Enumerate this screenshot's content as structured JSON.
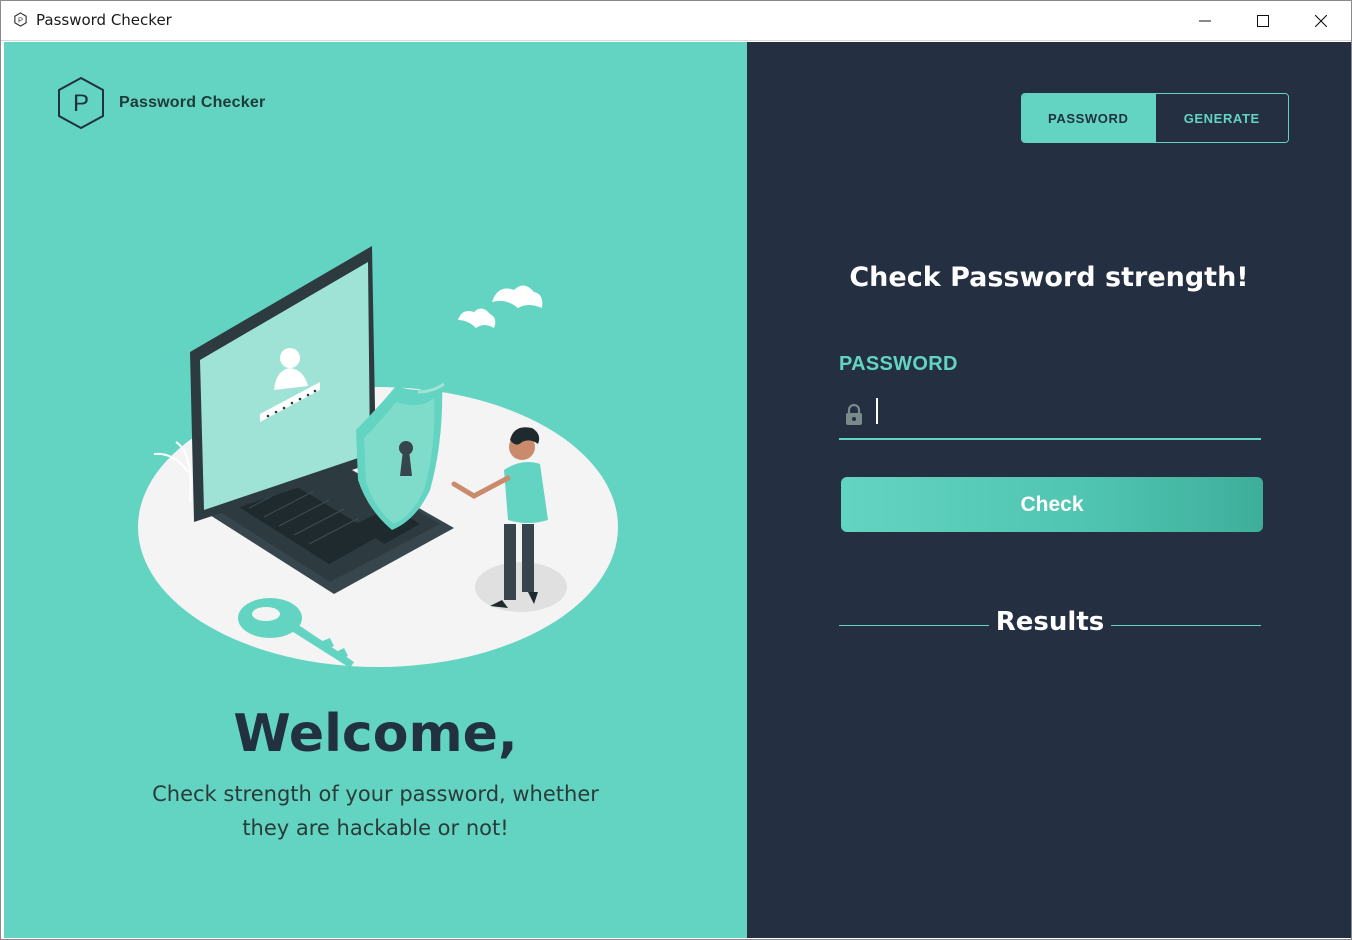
{
  "window": {
    "title": "Password Checker",
    "app_icon": "app-p-icon",
    "controls": [
      "minimize-icon",
      "maximize-icon",
      "close-icon"
    ]
  },
  "left": {
    "brand_letter": "P",
    "brand_name": "Password Checker",
    "welcome": "Welcome,",
    "subtitle_line1": "Check strength of your password, whether",
    "subtitle_line2": "they are hackable or not!",
    "illustration_icon": "laptop-security-illustration"
  },
  "right": {
    "tabs": [
      {
        "label": "PASSWORD",
        "active": true
      },
      {
        "label": "GENERATE",
        "active": false
      }
    ],
    "heading": "Check Password strength!",
    "field_label": "PASSWORD",
    "field_icon": "lock-icon",
    "password_value": "",
    "check_label": "Check",
    "results_label": "Results"
  },
  "colors": {
    "accent": "#63d4c1",
    "dark": "#242f42",
    "text_dark": "#22313f"
  }
}
